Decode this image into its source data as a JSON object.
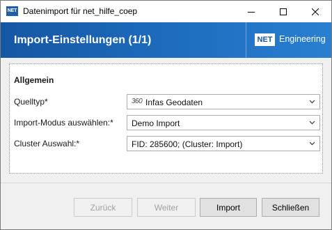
{
  "window": {
    "title": "Datenimport für net_hilfe_coep",
    "app_icon_text": "NET"
  },
  "banner": {
    "title": "Import-Einstellungen (1/1)",
    "brand_box": "NET",
    "brand_text": "Engineering"
  },
  "group": {
    "title": "Allgemein",
    "fields": [
      {
        "label": "Quelltyp*",
        "value": "Infas Geodaten",
        "icon": "360"
      },
      {
        "label": "Import-Modus auswählen:*",
        "value": "Demo Import"
      },
      {
        "label": "Cluster Auswahl:*",
        "value": "FID: 285600; (Cluster: Import)"
      }
    ]
  },
  "footer": {
    "back_label": "Zurück",
    "next_label": "Weiter",
    "import_label": "Import",
    "close_label": "Schließen"
  },
  "colors": {
    "banner": "#1e6dbf",
    "accent": "#1557a4"
  }
}
